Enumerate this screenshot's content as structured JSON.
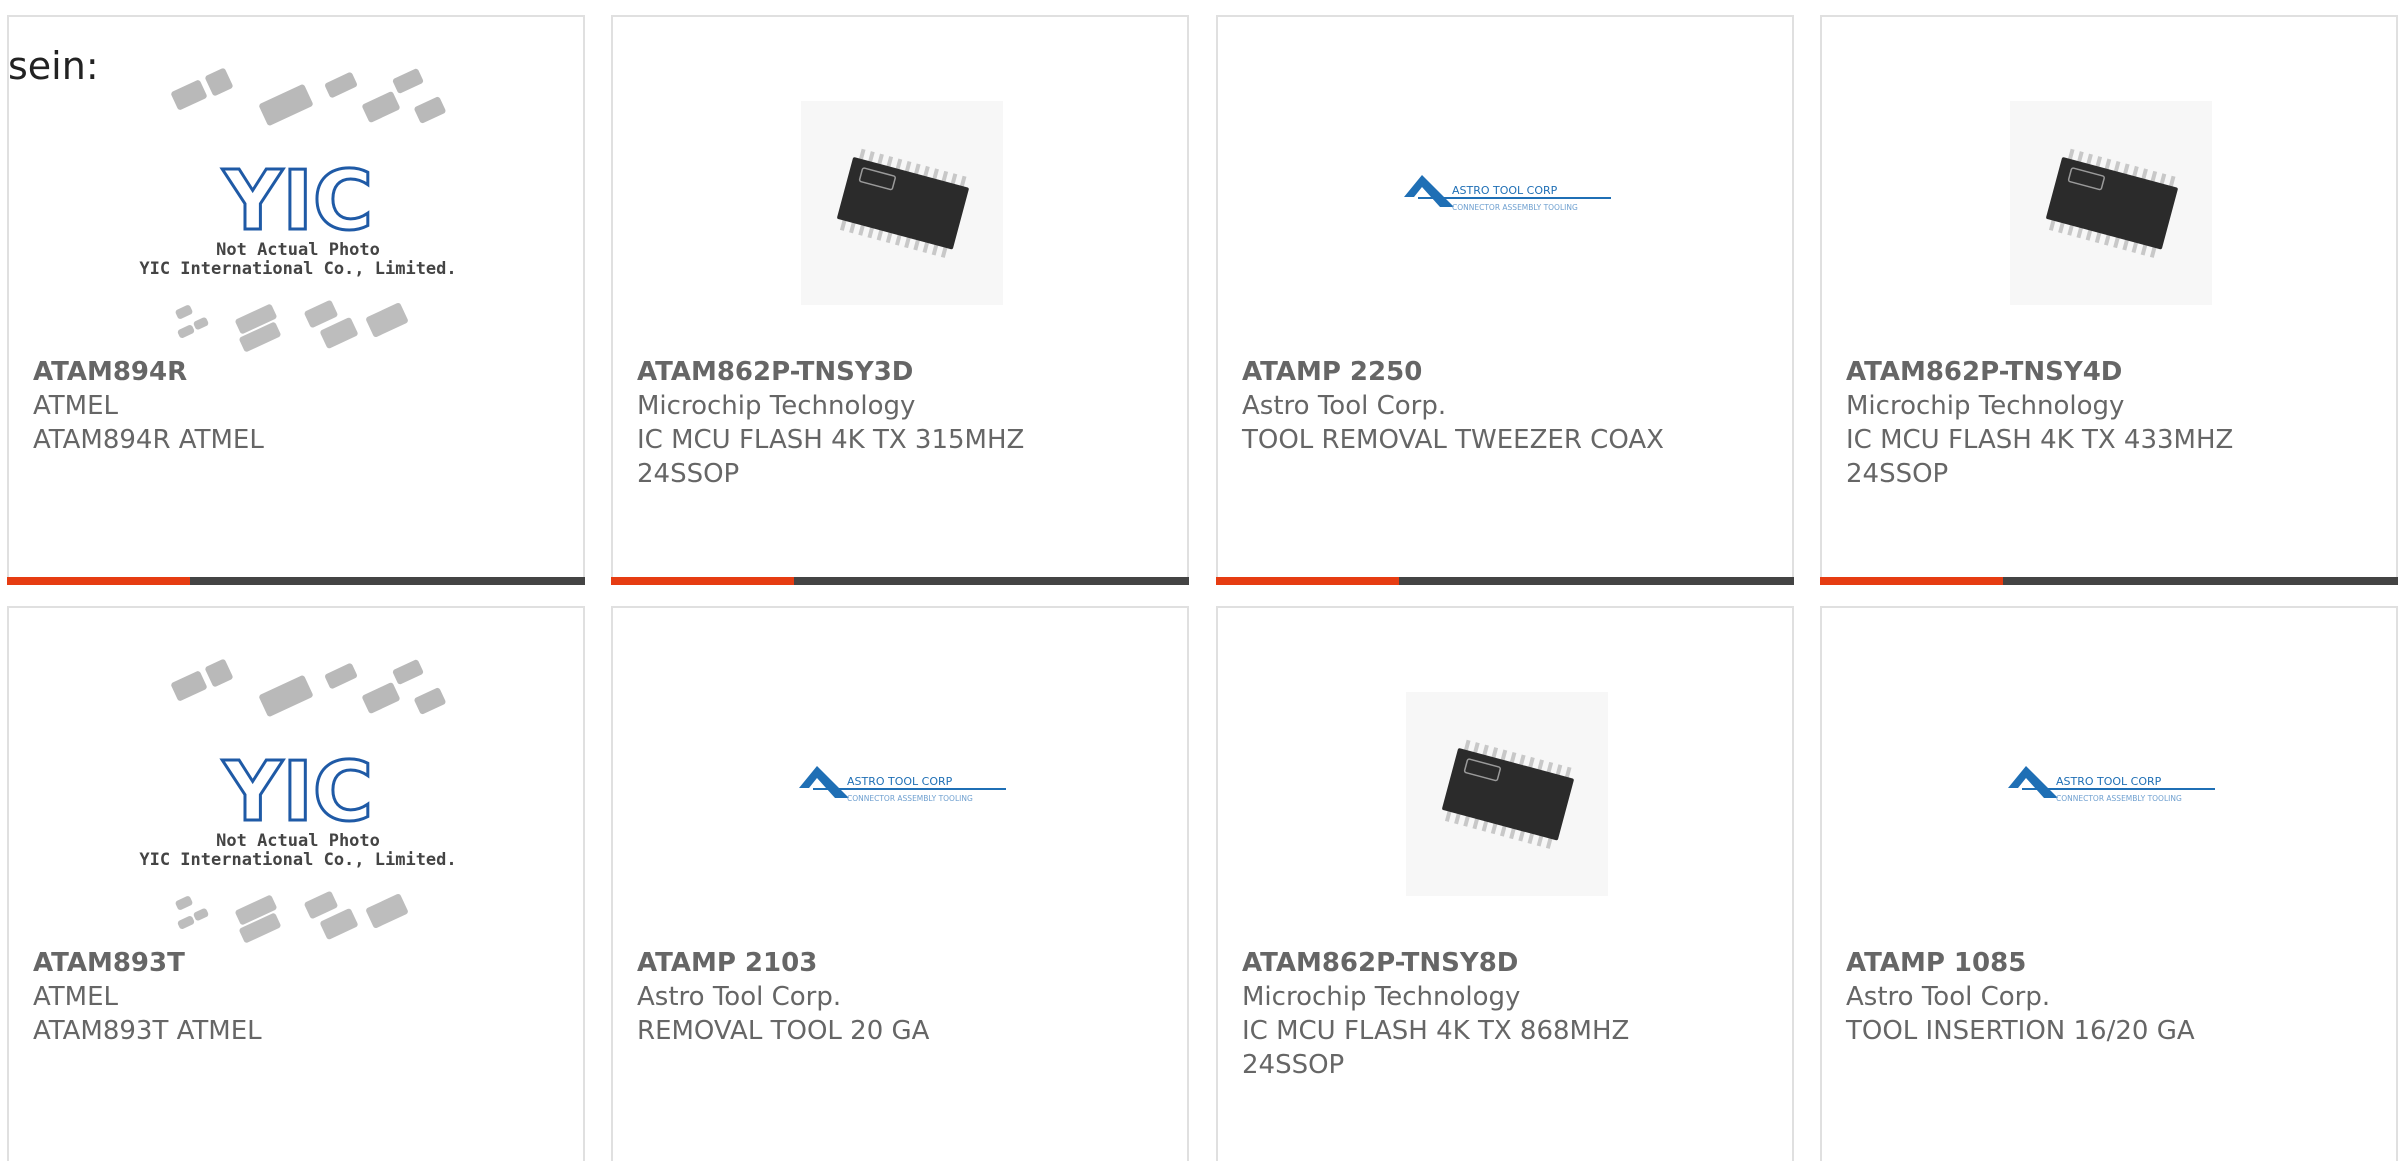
{
  "intro": "sein:",
  "colors": {
    "accent": "#e63c12",
    "bar_dark": "#444444",
    "text": "#666666",
    "border": "#e0e0e0",
    "yic_blue": "#1f5aa6",
    "astro_blue": "#1f6fb5"
  },
  "products": [
    {
      "part_number": "ATAM894R",
      "manufacturer": "ATMEL",
      "description": "ATAM894R ATMEL",
      "image": "yic-placeholder",
      "placeholder_caption_1": "Not Actual Photo",
      "placeholder_caption_2": "YIC International Co., Limited.",
      "placeholder_logo": "YIC"
    },
    {
      "part_number": "ATAM862P-TNSY3D",
      "manufacturer": "Microchip Technology",
      "description": "IC MCU FLASH 4K TX 315MHZ 24SSOP",
      "image": "ssop-chip"
    },
    {
      "part_number": "ATAMP 2250",
      "manufacturer": "Astro Tool Corp.",
      "description": "TOOL REMOVAL TWEEZER COAX",
      "image": "astro-logo",
      "logo_text": "ASTRO TOOL CORP",
      "logo_subtext": "CONNECTOR ASSEMBLY TOOLING"
    },
    {
      "part_number": "ATAM862P-TNSY4D",
      "manufacturer": "Microchip Technology",
      "description": "IC MCU FLASH 4K TX 433MHZ 24SSOP",
      "image": "ssop-chip"
    },
    {
      "part_number": "ATAM893T",
      "manufacturer": "ATMEL",
      "description": "ATAM893T ATMEL",
      "image": "yic-placeholder",
      "placeholder_caption_1": "Not Actual Photo",
      "placeholder_caption_2": "YIC International Co., Limited.",
      "placeholder_logo": "YIC"
    },
    {
      "part_number": "ATAMP 2103",
      "manufacturer": "Astro Tool Corp.",
      "description": "REMOVAL TOOL 20 GA",
      "image": "astro-logo",
      "logo_text": "ASTRO TOOL CORP",
      "logo_subtext": "CONNECTOR ASSEMBLY TOOLING"
    },
    {
      "part_number": "ATAM862P-TNSY8D",
      "manufacturer": "Microchip Technology",
      "description": "IC MCU FLASH 4K TX 868MHZ 24SSOP",
      "image": "ssop-chip"
    },
    {
      "part_number": "ATAMP 1085",
      "manufacturer": "Astro Tool Corp.",
      "description": "TOOL INSERTION 16/20 GA",
      "image": "astro-logo",
      "logo_text": "ASTRO TOOL CORP",
      "logo_subtext": "CONNECTOR ASSEMBLY TOOLING"
    }
  ]
}
